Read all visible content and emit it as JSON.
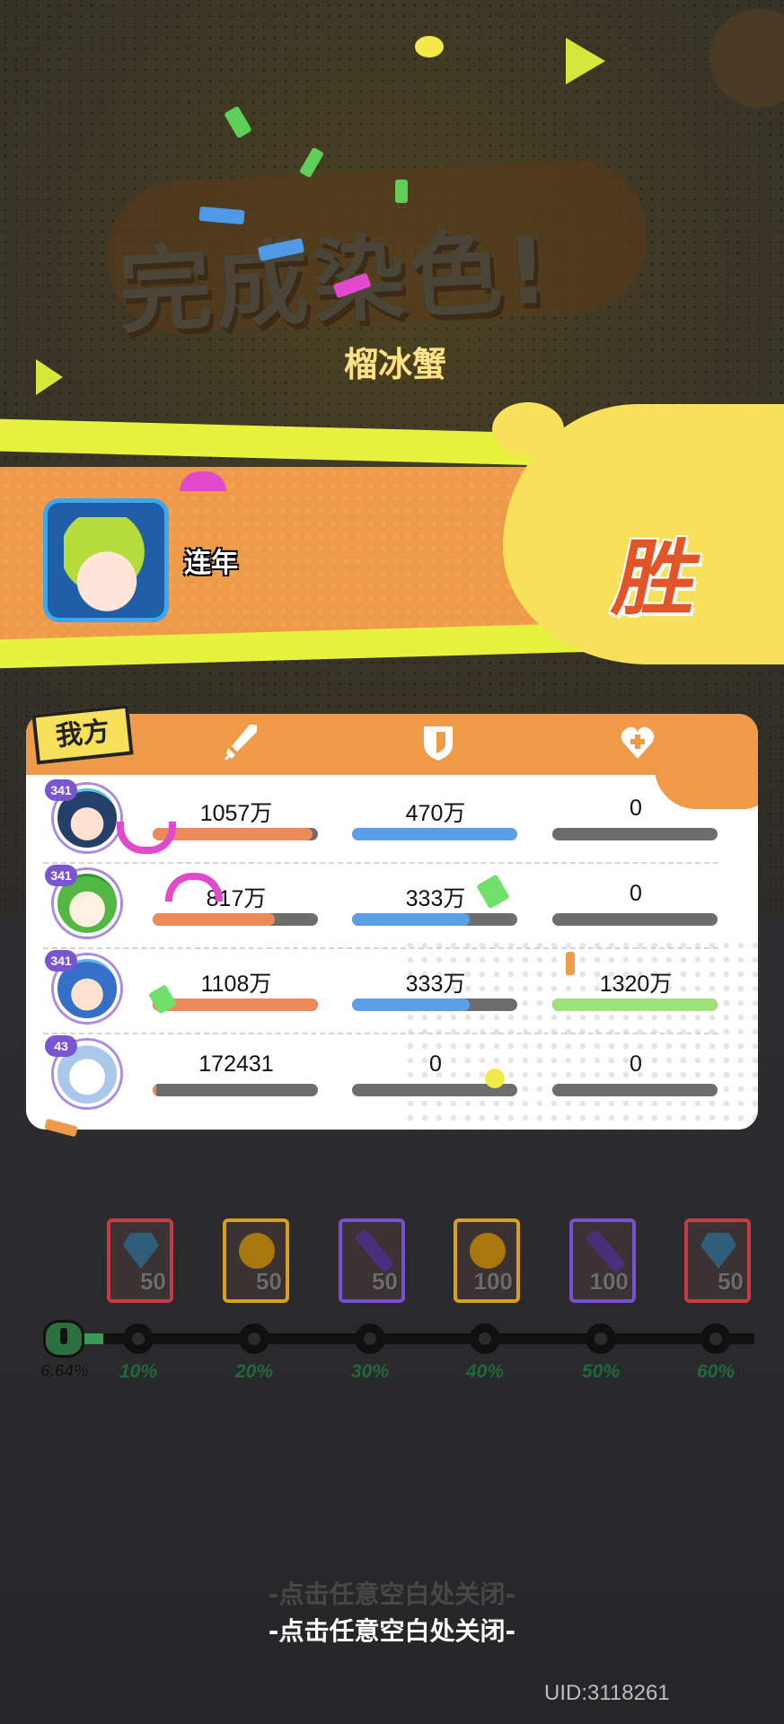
{
  "title": "完成染色!",
  "subtitle": "榴冰蟹",
  "player": {
    "name": "连年",
    "result": "胜"
  },
  "team_tag": "我方",
  "columns": [
    {
      "icon": "sword-icon"
    },
    {
      "icon": "shield-icon"
    },
    {
      "icon": "heart-plus-icon"
    }
  ],
  "units": [
    {
      "level": "341",
      "damage": "1057万",
      "damage_pct": 0.97,
      "defense": "470万",
      "defense_pct": 1.0,
      "heal": "0",
      "heal_pct": 0
    },
    {
      "level": "341",
      "damage": "817万",
      "damage_pct": 0.74,
      "defense": "333万",
      "defense_pct": 0.71,
      "heal": "0",
      "heal_pct": 0
    },
    {
      "level": "341",
      "damage": "1108万",
      "damage_pct": 1.0,
      "defense": "333万",
      "defense_pct": 0.71,
      "heal": "1320万",
      "heal_pct": 1.0
    },
    {
      "level": "43",
      "damage": "172431",
      "damage_pct": 0.02,
      "defense": "0",
      "defense_pct": 0,
      "heal": "0",
      "heal_pct": 0
    }
  ],
  "rewards": [
    {
      "icon": "diamond-icon",
      "amount": "50",
      "border": "#c73a4a"
    },
    {
      "icon": "coin-icon",
      "amount": "50",
      "border": "#d9a020"
    },
    {
      "icon": "crayon-icon",
      "amount": "50",
      "border": "#7a4fd6"
    },
    {
      "icon": "coin-icon",
      "amount": "100",
      "border": "#d9a020"
    },
    {
      "icon": "crayon-icon",
      "amount": "100",
      "border": "#7a4fd6"
    },
    {
      "icon": "diamond-icon",
      "amount": "50",
      "border": "#c73a4a"
    }
  ],
  "progress": {
    "current": "6.64%",
    "current_value": 0.0664,
    "milestones": [
      "10%",
      "20%",
      "30%",
      "40%",
      "50%",
      "60%"
    ]
  },
  "close_hint": "-点击任意空白处关闭-",
  "uid": "UID:3118261"
}
